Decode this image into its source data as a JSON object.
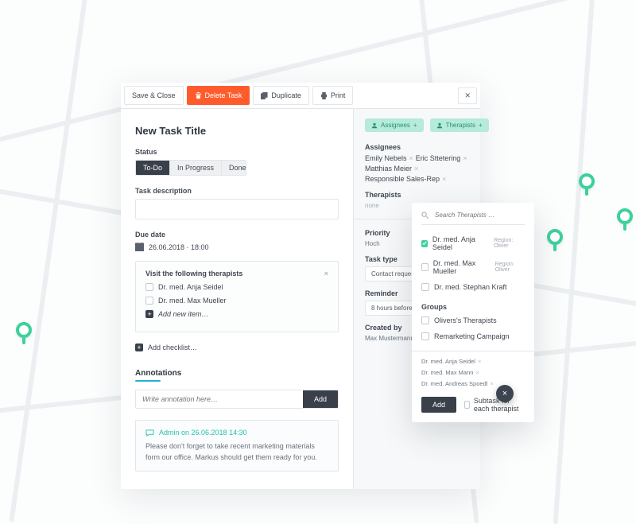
{
  "toolbar": {
    "save": "Save & Close",
    "delete": "Delete Task",
    "duplicate": "Duplicate",
    "print": "Print"
  },
  "title": "New Task Title",
  "status": {
    "label": "Status",
    "options": [
      "To-Do",
      "In Progress",
      "Done"
    ],
    "selected": 0
  },
  "desc_label": "Task description",
  "desc_value": "",
  "due": {
    "label": "Due date",
    "value": "26.06.2018 · 18:00"
  },
  "checklist": {
    "title": "Visit the following therapists",
    "items": [
      "Dr. med. Anja Seidel",
      "Dr. med. Max Mueller"
    ],
    "add_item": "Add new item…",
    "add_list": "Add checklist…"
  },
  "annotations": {
    "title": "Annotations",
    "placeholder": "Write annotation here…",
    "add": "Add",
    "note": {
      "meta": "Admin on 26.06.2018 14:30",
      "body": "Please don't forget to take recent marketing materials form our office. Markus should get them ready for you."
    }
  },
  "side": {
    "btn_assignees": "Assignees",
    "btn_therapists": "Therapists",
    "assignees_label": "Assignees",
    "assignees": [
      "Emily Nebels",
      "Eric Sttetering",
      "Matthias Meier",
      "Responsible Sales-Rep"
    ],
    "therapists_label": "Therapists",
    "therapists_none": "none",
    "priority_label": "Priority",
    "priority_value": "Hoch",
    "type_label": "Task type",
    "type_value": "Contact request",
    "reminder_label": "Reminder",
    "reminder_value": "8 hours before",
    "created_label": "Created by",
    "created_value": "Max Mustermann"
  },
  "popover": {
    "search_placeholder": "Search Therapists …",
    "options": [
      {
        "name": "Dr. med. Anja Seidel",
        "region": "Region: Oliver",
        "checked": true
      },
      {
        "name": "Dr. med. Max Mueller",
        "region": "Region: Oliver",
        "checked": false
      },
      {
        "name": "Dr. med. Stephan Kraft",
        "region": "",
        "checked": false
      }
    ],
    "groups_label": "Groups",
    "groups": [
      "Olivers's Therapists",
      "Remarketing Campaign"
    ],
    "selected": [
      "Dr. med. Anja Seidel",
      "Dr. med. Max Mann",
      "Dr. med. Andreas Spoedl"
    ],
    "add": "Add",
    "subtask_label": "Subtask for each therapist"
  }
}
